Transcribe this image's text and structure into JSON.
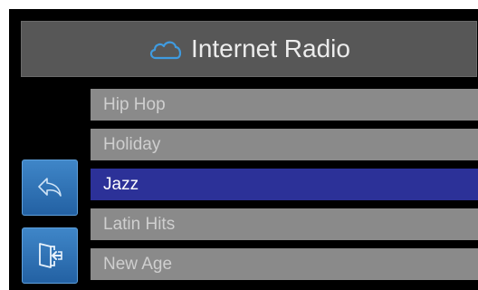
{
  "header": {
    "title": "Internet Radio",
    "icon": "cloud-icon"
  },
  "list": {
    "items": [
      {
        "label": "Hip Hop",
        "selected": false
      },
      {
        "label": "Holiday",
        "selected": false
      },
      {
        "label": "Jazz",
        "selected": true
      },
      {
        "label": "Latin Hits",
        "selected": false
      },
      {
        "label": "New Age",
        "selected": false
      }
    ]
  },
  "sidebar": {
    "back_icon": "back-arrow-icon",
    "exit_icon": "exit-door-icon"
  },
  "colors": {
    "background": "#000000",
    "header_bg": "#575757",
    "row_bg": "#8a8a8a",
    "row_text": "#cfcfcf",
    "selected_bg": "#2c3198",
    "selected_text": "#ffffff",
    "button_blue": "#2f74b8",
    "cloud_blue": "#3f9be0"
  }
}
